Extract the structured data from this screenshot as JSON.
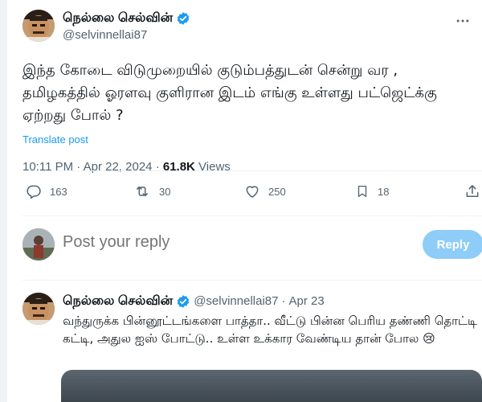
{
  "tweet": {
    "display_name": "நெல்லை செல்வின்",
    "handle": "@selvinnellai87",
    "more_icon": "more-horizontal-icon",
    "text": "இந்த கோடை விடுமுறையில் குடும்பத்துடன் சென்று வர , தமிழகத்தில் ஓரளவு குளிரான இடம் எங்கு உள்ளது பட்ஜெட்க்கு ஏற்றது போல் ?",
    "translate_label": "Translate post",
    "time": "10:11 PM",
    "date": "Apr 22, 2024",
    "views_count": "61.8K",
    "views_label": "Views",
    "verified_color": "#1d9bf0"
  },
  "actions": {
    "replies": "163",
    "reposts": "30",
    "likes": "250",
    "bookmarks": "18"
  },
  "composer": {
    "placeholder": "Post your reply",
    "button_label": "Reply"
  },
  "reply": {
    "display_name": "நெல்லை செல்வின்",
    "handle": "@selvinnellai87",
    "separator": "·",
    "date": "Apr 23",
    "text": "வந்துருக்க பின்னூட்டங்களை பாத்தா.. வீட்டு பின்ன பெரிய தண்ணி தொட்டி கட்டி, அதுல ஐஸ் போட்டு.. உள்ள உக்கார வேண்டிய தான் போல 😢"
  }
}
